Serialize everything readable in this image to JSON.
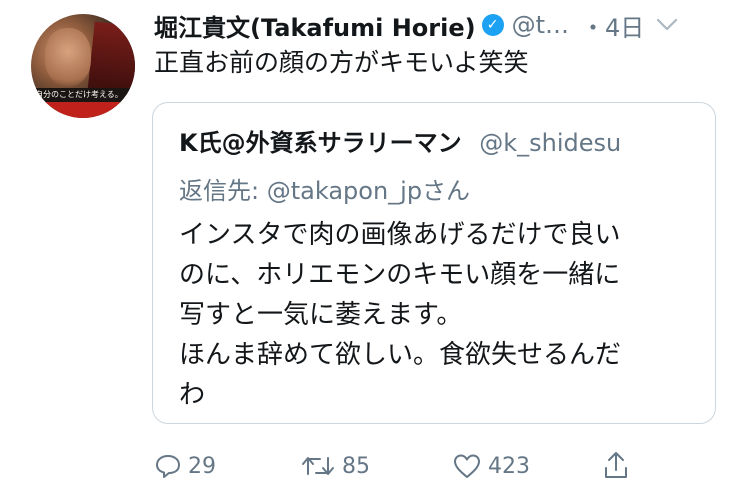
{
  "author": {
    "name": "堀江貴文(Takafumi Horie)",
    "handle": "@t…",
    "time": "・4日",
    "avatar_caption": "自分のことだけ考える。"
  },
  "tweet": {
    "text": "正直お前の顔の方がキモいよ笑笑"
  },
  "quote": {
    "name": "K氏@外資系サラリーマン",
    "handle": "@k_shidesu",
    "reply_prefix": "返信先: ",
    "reply_to": "@takapon_jpさん",
    "lines": [
      "インスタで肉の画像あげるだけで良い",
      "のに、ホリエモンのキモい顔を一緒に",
      "写すと一気に萎えます。",
      "ほんま辞めて欲しい。食欲失せるんだ",
      "わ"
    ]
  },
  "actions": {
    "reply_count": "29",
    "retweet_count": "85",
    "like_count": "423"
  },
  "colors": {
    "accent": "#1da1f2",
    "muted": "#657786",
    "border": "#ccd6dd",
    "text": "#14171a"
  },
  "icons": [
    "verified-badge-icon",
    "chevron-down-icon",
    "reply-icon",
    "retweet-icon",
    "like-icon",
    "share-icon"
  ]
}
